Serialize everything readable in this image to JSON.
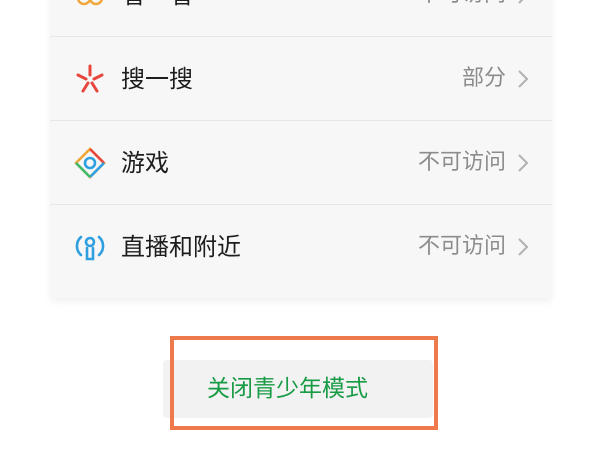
{
  "settings_list": {
    "items": [
      {
        "label": "看一看",
        "value": "不可访问",
        "icon": "look-icon"
      },
      {
        "label": "搜一搜",
        "value": "部分",
        "icon": "search-star-icon"
      },
      {
        "label": "游戏",
        "value": "不可访问",
        "icon": "game-icon"
      },
      {
        "label": "直播和附近",
        "value": "不可访问",
        "icon": "live-nearby-icon"
      }
    ]
  },
  "footer": {
    "close_button_label": "关闭青少年模式"
  },
  "colors": {
    "card_bg": "#f7f7f7",
    "label_text": "#1d1d1d",
    "value_text": "#8c8c8c",
    "button_text": "#179b44",
    "highlight_border": "#ee7a4c",
    "look_icon": "#f0a63a",
    "search_icon": "#e8453c",
    "live_icon": "#2f9fe0"
  }
}
